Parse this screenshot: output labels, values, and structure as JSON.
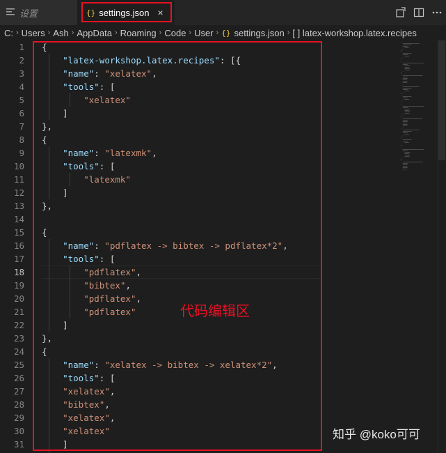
{
  "tabs": [
    {
      "label": "设置",
      "icon": "settings-list-icon"
    },
    {
      "label": "settings.json",
      "icon": "json-braces-icon",
      "close": "×"
    }
  ],
  "breadcrumb": {
    "items": [
      "C:",
      "Users",
      "Ash",
      "AppData",
      "Roaming",
      "Code",
      "User",
      "settings.json",
      "[ ] latex-workshop.latex.recipes"
    ],
    "separator": "›"
  },
  "editor": {
    "line_numbers": [
      "1",
      "2",
      "3",
      "4",
      "5",
      "6",
      "7",
      "8",
      "9",
      "10",
      "11",
      "12",
      "13",
      "14",
      "15",
      "16",
      "17",
      "18",
      "19",
      "20",
      "21",
      "22",
      "23",
      "24",
      "25",
      "26",
      "27",
      "28",
      "29",
      "30",
      "31"
    ],
    "active_line": "18",
    "lines": [
      [
        {
          "t": "{"
        }
      ],
      [
        {
          "t": "    "
        },
        {
          "t": "\"latex-workshop.latex.recipes\"",
          "c": "k"
        },
        {
          "t": ": [{"
        }
      ],
      [
        {
          "t": "    "
        },
        {
          "t": "\"name\"",
          "c": "k"
        },
        {
          "t": ": "
        },
        {
          "t": "\"xelatex\"",
          "c": "s"
        },
        {
          "t": ","
        }
      ],
      [
        {
          "t": "    "
        },
        {
          "t": "\"tools\"",
          "c": "k"
        },
        {
          "t": ": ["
        }
      ],
      [
        {
          "t": "        "
        },
        {
          "t": "\"xelatex\"",
          "c": "s"
        }
      ],
      [
        {
          "t": "    ]"
        }
      ],
      [
        {
          "t": "},"
        }
      ],
      [
        {
          "t": "{"
        }
      ],
      [
        {
          "t": "    "
        },
        {
          "t": "\"name\"",
          "c": "k"
        },
        {
          "t": ": "
        },
        {
          "t": "\"latexmk\"",
          "c": "s"
        },
        {
          "t": ","
        }
      ],
      [
        {
          "t": "    "
        },
        {
          "t": "\"tools\"",
          "c": "k"
        },
        {
          "t": ": ["
        }
      ],
      [
        {
          "t": "        "
        },
        {
          "t": "\"latexmk\"",
          "c": "s"
        }
      ],
      [
        {
          "t": "    ]"
        }
      ],
      [
        {
          "t": "},"
        }
      ],
      [],
      [
        {
          "t": "{"
        }
      ],
      [
        {
          "t": "    "
        },
        {
          "t": "\"name\"",
          "c": "k"
        },
        {
          "t": ": "
        },
        {
          "t": "\"pdflatex -> bibtex -> pdflatex*2\"",
          "c": "s"
        },
        {
          "t": ","
        }
      ],
      [
        {
          "t": "    "
        },
        {
          "t": "\"tools\"",
          "c": "k"
        },
        {
          "t": ": ["
        }
      ],
      [
        {
          "t": "        "
        },
        {
          "t": "\"pdflatex\"",
          "c": "s"
        },
        {
          "t": ","
        }
      ],
      [
        {
          "t": "        "
        },
        {
          "t": "\"bibtex\"",
          "c": "s"
        },
        {
          "t": ","
        }
      ],
      [
        {
          "t": "        "
        },
        {
          "t": "\"pdflatex\"",
          "c": "s"
        },
        {
          "t": ","
        }
      ],
      [
        {
          "t": "        "
        },
        {
          "t": "\"pdflatex\"",
          "c": "s"
        }
      ],
      [
        {
          "t": "    ]"
        }
      ],
      [
        {
          "t": "},"
        }
      ],
      [
        {
          "t": "{"
        }
      ],
      [
        {
          "t": "    "
        },
        {
          "t": "\"name\"",
          "c": "k"
        },
        {
          "t": ": "
        },
        {
          "t": "\"xelatex -> bibtex -> xelatex*2\"",
          "c": "s"
        },
        {
          "t": ","
        }
      ],
      [
        {
          "t": "    "
        },
        {
          "t": "\"tools\"",
          "c": "k"
        },
        {
          "t": ": ["
        }
      ],
      [
        {
          "t": "    "
        },
        {
          "t": "\"xelatex\"",
          "c": "s"
        },
        {
          "t": ","
        }
      ],
      [
        {
          "t": "    "
        },
        {
          "t": "\"bibtex\"",
          "c": "s"
        },
        {
          "t": ","
        }
      ],
      [
        {
          "t": "    "
        },
        {
          "t": "\"xelatex\"",
          "c": "s"
        },
        {
          "t": ","
        }
      ],
      [
        {
          "t": "    "
        },
        {
          "t": "\"xelatex\"",
          "c": "s"
        }
      ],
      [
        {
          "t": "    ]"
        }
      ]
    ]
  },
  "annotation": {
    "label": "代码编辑区"
  },
  "watermark": "知乎 @koko可可",
  "colors": {
    "highlight": "#e81123",
    "key": "#9cdcfe",
    "string": "#ce9178",
    "brace_icon": "#e8c43a"
  }
}
